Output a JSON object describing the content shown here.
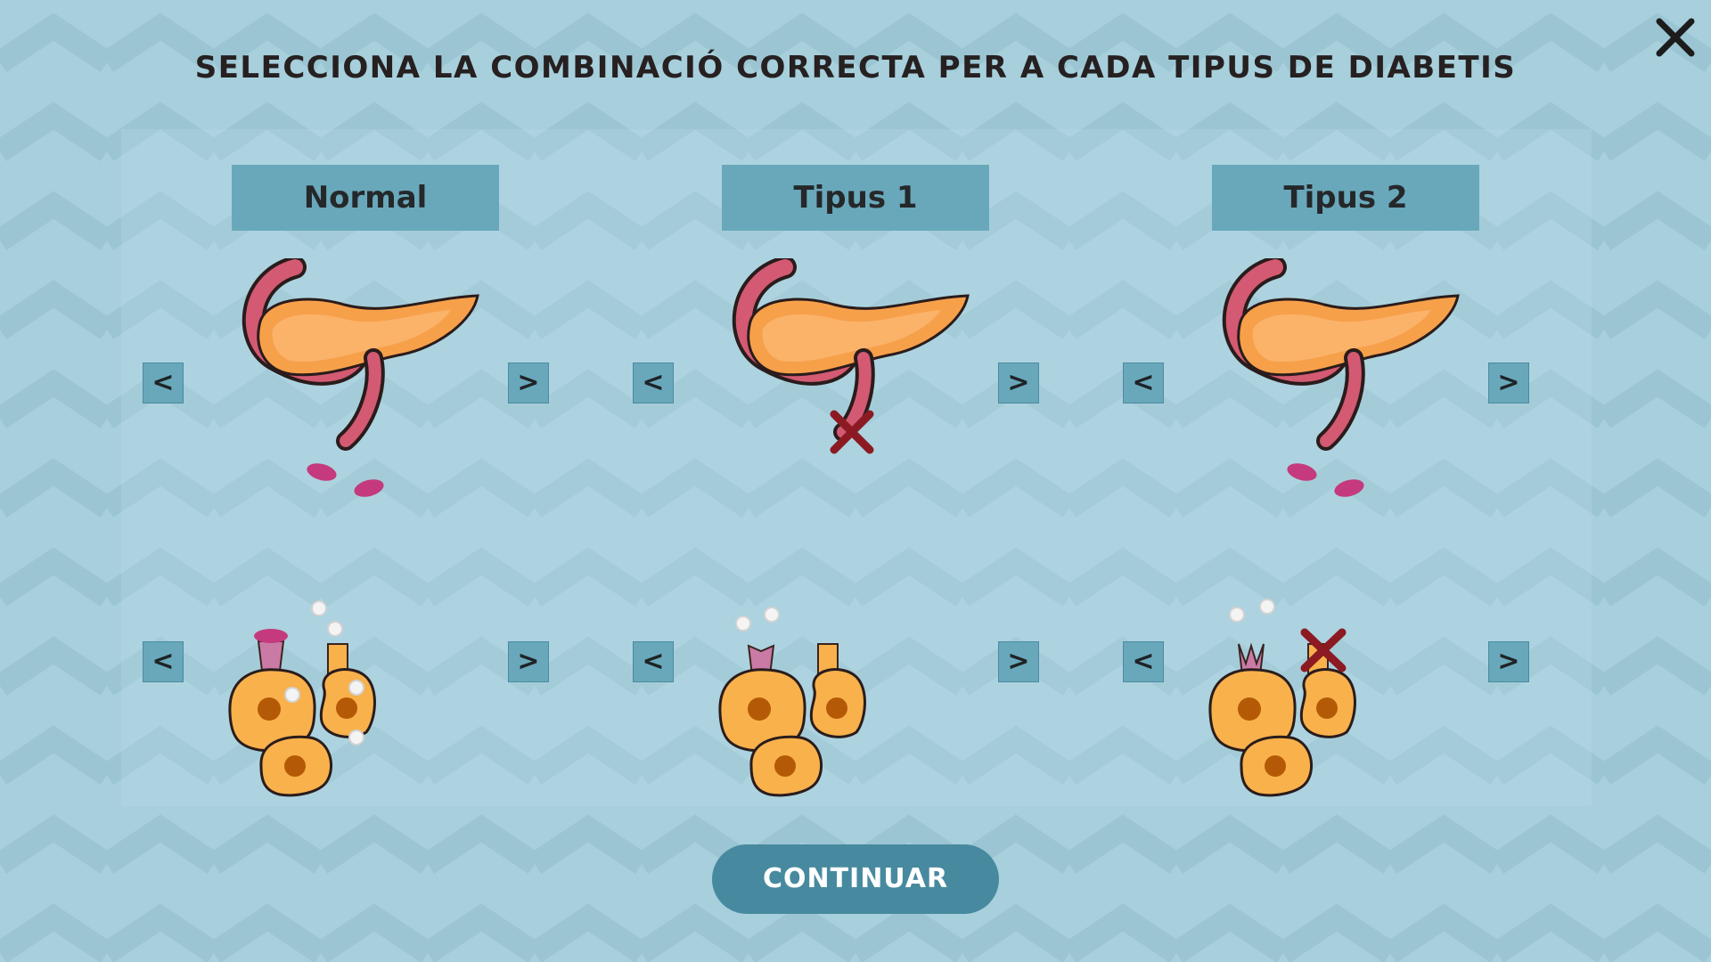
{
  "header": {
    "title": "SELECCIONA LA COMBINACIÓ CORRECTA PER A CADA TIPUS DE DIABETIS",
    "close_icon": "close-icon"
  },
  "columns": [
    {
      "label": "Normal",
      "pancreas": {
        "insulin_released": true,
        "blocked": false
      },
      "cells": {
        "insulin_bound": true,
        "receptor_blocked": false,
        "glucose_inside": true
      }
    },
    {
      "label": "Tipus 1",
      "pancreas": {
        "insulin_released": false,
        "blocked": true
      },
      "cells": {
        "insulin_bound": false,
        "receptor_blocked": false,
        "glucose_inside": false
      }
    },
    {
      "label": "Tipus 2",
      "pancreas": {
        "insulin_released": true,
        "blocked": false
      },
      "cells": {
        "insulin_bound": false,
        "receptor_blocked": true,
        "glucose_inside": false
      }
    }
  ],
  "controls": {
    "prev_label": "<",
    "next_label": ">"
  },
  "footer": {
    "continue_label": "CONTINUAR"
  },
  "colors": {
    "background": "#a7cfdc",
    "chevron": "#9dc6d3",
    "accent": "#69a8bb",
    "button": "#478a9f",
    "pancreas": "#f7a04a",
    "duct": "#d35a72",
    "insulin": "#c53a7e",
    "cell": "#f9b14c",
    "nucleus": "#b45a06",
    "receptor": "#c97ba6",
    "x_mark": "#8c1a22"
  }
}
